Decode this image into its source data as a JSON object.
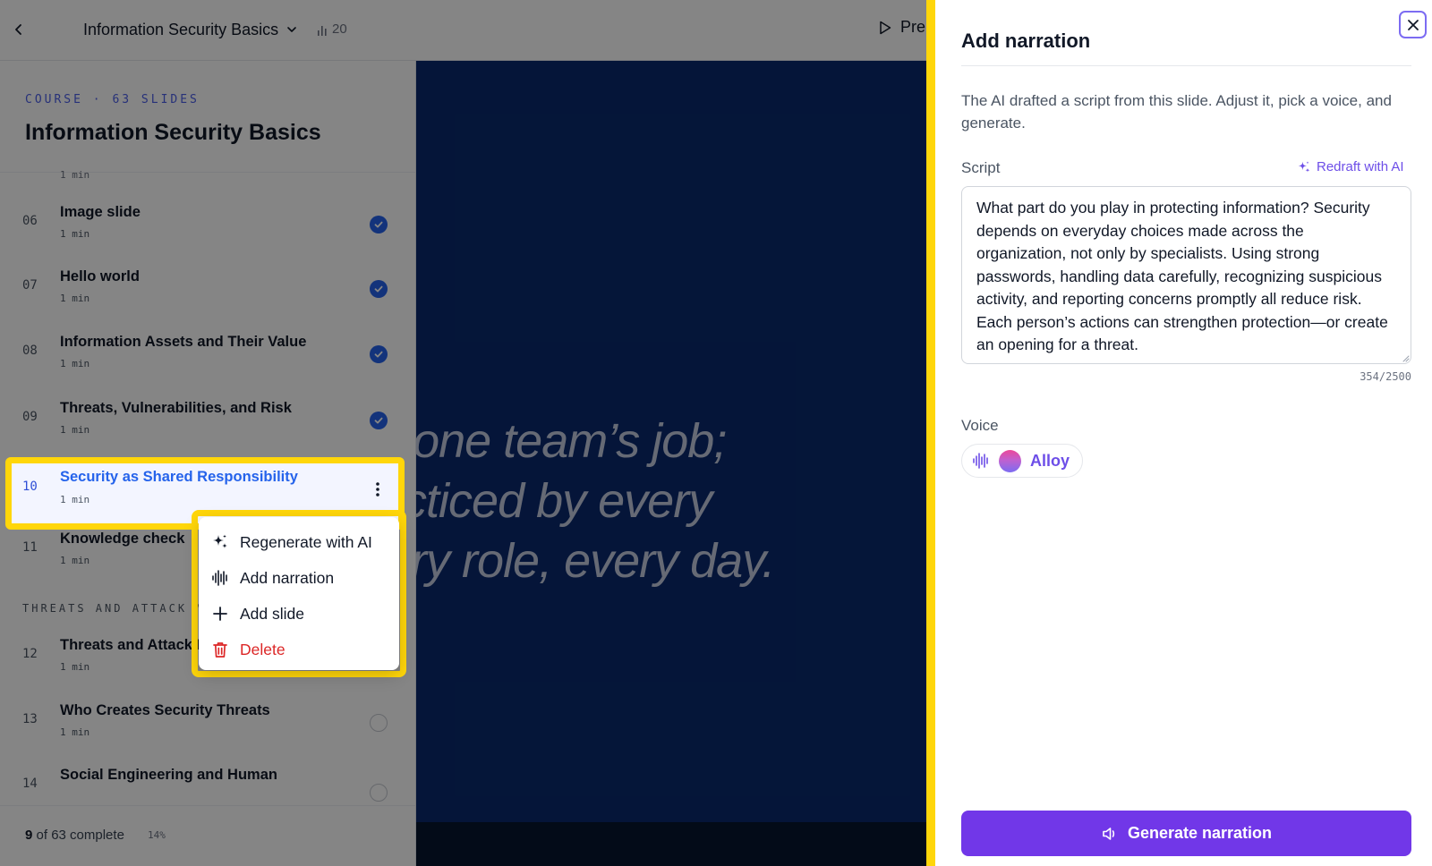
{
  "topbar": {
    "course_name": "Information Security Basics",
    "slide_count": "20",
    "preview_label": "Pre"
  },
  "sidebar": {
    "eyebrow": "COURSE · 63 SLIDES",
    "course_title": "Information Security Basics",
    "clipped_duration": "1 min",
    "slides": [
      {
        "num": "06",
        "title": "Image slide",
        "duration": "1 min",
        "status": "done"
      },
      {
        "num": "07",
        "title": "Hello world",
        "duration": "1 min",
        "status": "done"
      },
      {
        "num": "08",
        "title": "Information Assets and Their Value",
        "duration": "1 min",
        "status": "done"
      },
      {
        "num": "09",
        "title": "Threats, Vulnerabilities, and Risk",
        "duration": "1 min",
        "status": "done"
      },
      {
        "num": "10",
        "title": "Security as Shared Responsibility",
        "duration": "1 min",
        "status": "active"
      },
      {
        "num": "11",
        "title": "Knowledge check",
        "duration": "1 min",
        "status": "todo"
      },
      {
        "num": "12",
        "title": "Threats and Attack M",
        "duration": "1 min",
        "status": "todo"
      },
      {
        "num": "13",
        "title": "Who Creates Security Threats",
        "duration": "1 min",
        "status": "todo"
      },
      {
        "num": "14",
        "title": "Social Engineering and Human",
        "duration": "1 min",
        "status": "todo"
      }
    ],
    "section_label": "THREATS AND ATTACK ME",
    "progress_done": "9",
    "progress_rest": "of 63 complete",
    "progress_pct": "14%"
  },
  "canvas": {
    "lines": [
      "not one team’s job;",
      "practiced by every",
      "every role, every day."
    ]
  },
  "context_menu": {
    "items": [
      {
        "label": "Regenerate with AI",
        "icon": "sparkle-icon"
      },
      {
        "label": "Add narration",
        "icon": "waveform-icon"
      },
      {
        "label": "Add slide",
        "icon": "plus-icon"
      },
      {
        "label": "Delete",
        "icon": "trash-icon"
      }
    ]
  },
  "drawer": {
    "title": "Add narration",
    "description": "The AI drafted a script from this slide. Adjust it, pick a voice, and generate.",
    "script_label": "Script",
    "redraft_label": "Redraft with AI",
    "script_text": "What part do you play in protecting information? Security depends on everyday choices made across the organization, not only by specialists. Using strong passwords, handling data carefully, recognizing suspicious activity, and reporting concerns promptly all reduce risk. Each person’s actions can strengthen protection—or create an opening for a threat.",
    "char_count": "354/2500",
    "voice_label": "Voice",
    "voice_name": "Alloy",
    "generate_label": "Generate narration"
  },
  "colors": {
    "accent": "#7137e8",
    "highlight": "#ffd60a",
    "link_blue": "#2563eb",
    "danger": "#dc2626",
    "slide_bg": "#0a2a6e"
  }
}
